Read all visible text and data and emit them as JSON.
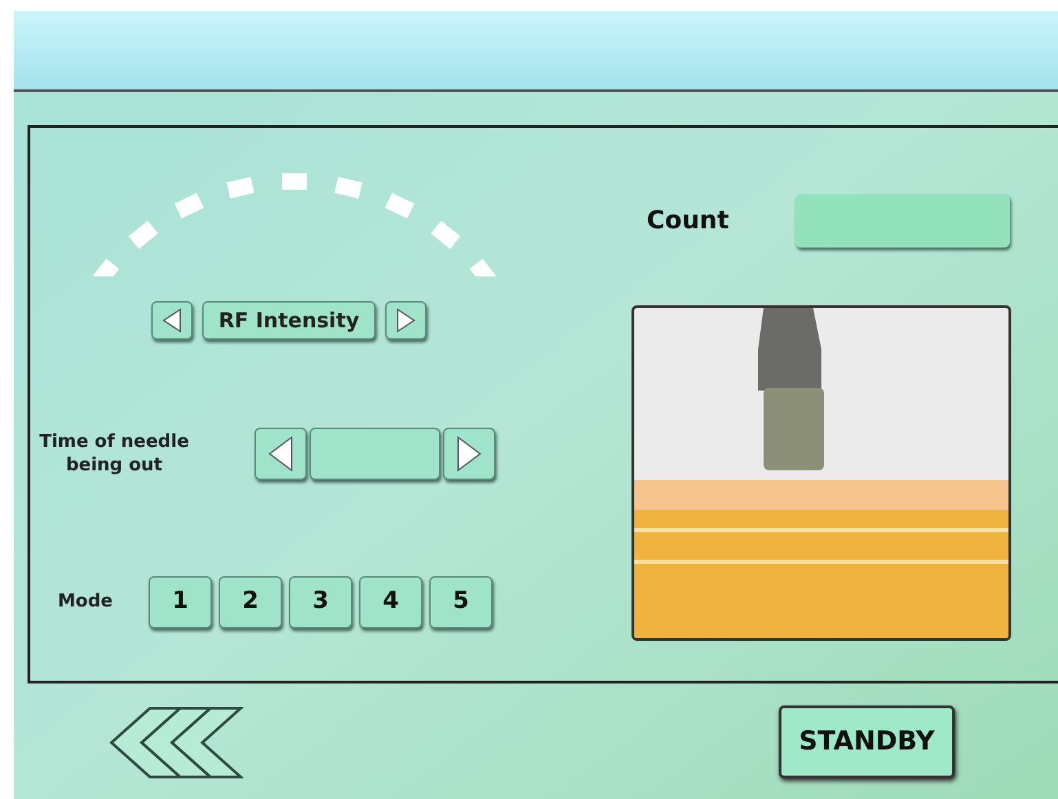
{
  "intensity_control": {
    "label": "RF Intensity"
  },
  "needle_time": {
    "label": "Time of needle\nbeing out"
  },
  "mode": {
    "label": "Mode",
    "options": [
      {
        "label": "1",
        "selected": false
      },
      {
        "label": "2",
        "selected": false
      },
      {
        "label": "3",
        "selected": false
      },
      {
        "label": "4",
        "selected": false
      },
      {
        "label": "5",
        "selected": false
      }
    ]
  },
  "count": {
    "label": "Count"
  },
  "standby_button": {
    "label": "STANDBY"
  }
}
